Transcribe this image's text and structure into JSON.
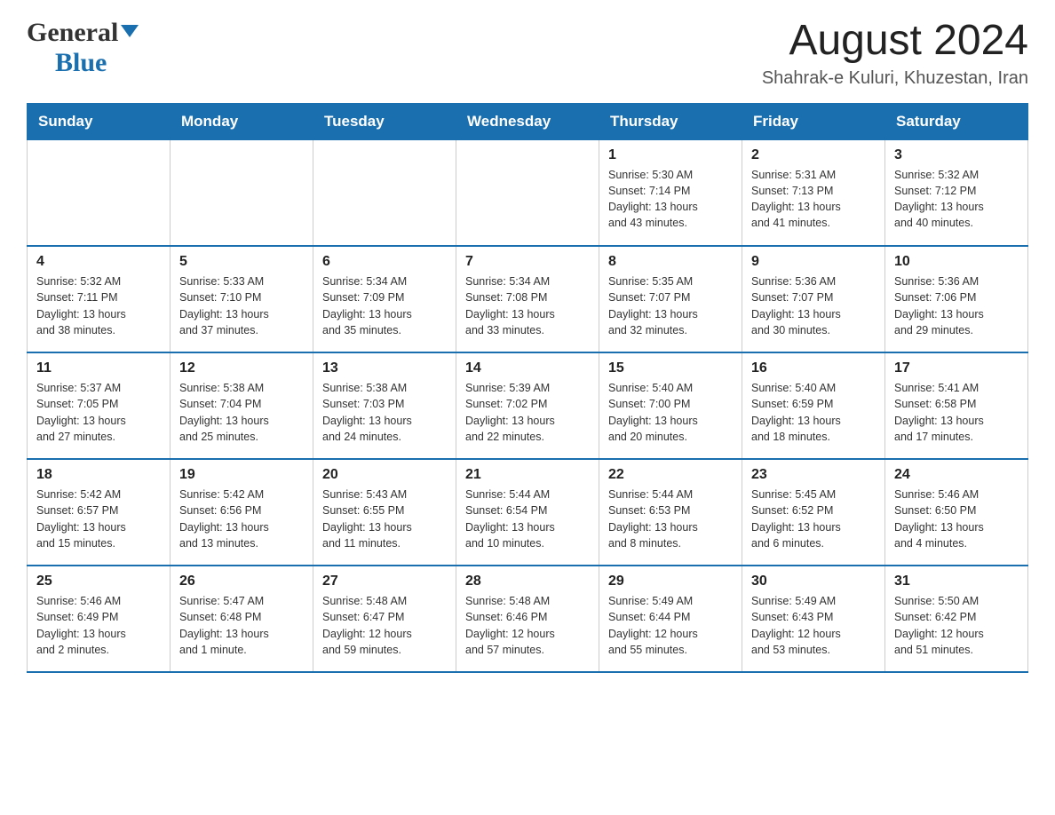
{
  "header": {
    "logo_general": "General",
    "logo_blue": "Blue",
    "month_title": "August 2024",
    "location": "Shahrak-e Kuluri, Khuzestan, Iran"
  },
  "days_of_week": [
    "Sunday",
    "Monday",
    "Tuesday",
    "Wednesday",
    "Thursday",
    "Friday",
    "Saturday"
  ],
  "weeks": [
    {
      "cells": [
        {
          "day": "",
          "info": ""
        },
        {
          "day": "",
          "info": ""
        },
        {
          "day": "",
          "info": ""
        },
        {
          "day": "",
          "info": ""
        },
        {
          "day": "1",
          "info": "Sunrise: 5:30 AM\nSunset: 7:14 PM\nDaylight: 13 hours\nand 43 minutes."
        },
        {
          "day": "2",
          "info": "Sunrise: 5:31 AM\nSunset: 7:13 PM\nDaylight: 13 hours\nand 41 minutes."
        },
        {
          "day": "3",
          "info": "Sunrise: 5:32 AM\nSunset: 7:12 PM\nDaylight: 13 hours\nand 40 minutes."
        }
      ]
    },
    {
      "cells": [
        {
          "day": "4",
          "info": "Sunrise: 5:32 AM\nSunset: 7:11 PM\nDaylight: 13 hours\nand 38 minutes."
        },
        {
          "day": "5",
          "info": "Sunrise: 5:33 AM\nSunset: 7:10 PM\nDaylight: 13 hours\nand 37 minutes."
        },
        {
          "day": "6",
          "info": "Sunrise: 5:34 AM\nSunset: 7:09 PM\nDaylight: 13 hours\nand 35 minutes."
        },
        {
          "day": "7",
          "info": "Sunrise: 5:34 AM\nSunset: 7:08 PM\nDaylight: 13 hours\nand 33 minutes."
        },
        {
          "day": "8",
          "info": "Sunrise: 5:35 AM\nSunset: 7:07 PM\nDaylight: 13 hours\nand 32 minutes."
        },
        {
          "day": "9",
          "info": "Sunrise: 5:36 AM\nSunset: 7:07 PM\nDaylight: 13 hours\nand 30 minutes."
        },
        {
          "day": "10",
          "info": "Sunrise: 5:36 AM\nSunset: 7:06 PM\nDaylight: 13 hours\nand 29 minutes."
        }
      ]
    },
    {
      "cells": [
        {
          "day": "11",
          "info": "Sunrise: 5:37 AM\nSunset: 7:05 PM\nDaylight: 13 hours\nand 27 minutes."
        },
        {
          "day": "12",
          "info": "Sunrise: 5:38 AM\nSunset: 7:04 PM\nDaylight: 13 hours\nand 25 minutes."
        },
        {
          "day": "13",
          "info": "Sunrise: 5:38 AM\nSunset: 7:03 PM\nDaylight: 13 hours\nand 24 minutes."
        },
        {
          "day": "14",
          "info": "Sunrise: 5:39 AM\nSunset: 7:02 PM\nDaylight: 13 hours\nand 22 minutes."
        },
        {
          "day": "15",
          "info": "Sunrise: 5:40 AM\nSunset: 7:00 PM\nDaylight: 13 hours\nand 20 minutes."
        },
        {
          "day": "16",
          "info": "Sunrise: 5:40 AM\nSunset: 6:59 PM\nDaylight: 13 hours\nand 18 minutes."
        },
        {
          "day": "17",
          "info": "Sunrise: 5:41 AM\nSunset: 6:58 PM\nDaylight: 13 hours\nand 17 minutes."
        }
      ]
    },
    {
      "cells": [
        {
          "day": "18",
          "info": "Sunrise: 5:42 AM\nSunset: 6:57 PM\nDaylight: 13 hours\nand 15 minutes."
        },
        {
          "day": "19",
          "info": "Sunrise: 5:42 AM\nSunset: 6:56 PM\nDaylight: 13 hours\nand 13 minutes."
        },
        {
          "day": "20",
          "info": "Sunrise: 5:43 AM\nSunset: 6:55 PM\nDaylight: 13 hours\nand 11 minutes."
        },
        {
          "day": "21",
          "info": "Sunrise: 5:44 AM\nSunset: 6:54 PM\nDaylight: 13 hours\nand 10 minutes."
        },
        {
          "day": "22",
          "info": "Sunrise: 5:44 AM\nSunset: 6:53 PM\nDaylight: 13 hours\nand 8 minutes."
        },
        {
          "day": "23",
          "info": "Sunrise: 5:45 AM\nSunset: 6:52 PM\nDaylight: 13 hours\nand 6 minutes."
        },
        {
          "day": "24",
          "info": "Sunrise: 5:46 AM\nSunset: 6:50 PM\nDaylight: 13 hours\nand 4 minutes."
        }
      ]
    },
    {
      "cells": [
        {
          "day": "25",
          "info": "Sunrise: 5:46 AM\nSunset: 6:49 PM\nDaylight: 13 hours\nand 2 minutes."
        },
        {
          "day": "26",
          "info": "Sunrise: 5:47 AM\nSunset: 6:48 PM\nDaylight: 13 hours\nand 1 minute."
        },
        {
          "day": "27",
          "info": "Sunrise: 5:48 AM\nSunset: 6:47 PM\nDaylight: 12 hours\nand 59 minutes."
        },
        {
          "day": "28",
          "info": "Sunrise: 5:48 AM\nSunset: 6:46 PM\nDaylight: 12 hours\nand 57 minutes."
        },
        {
          "day": "29",
          "info": "Sunrise: 5:49 AM\nSunset: 6:44 PM\nDaylight: 12 hours\nand 55 minutes."
        },
        {
          "day": "30",
          "info": "Sunrise: 5:49 AM\nSunset: 6:43 PM\nDaylight: 12 hours\nand 53 minutes."
        },
        {
          "day": "31",
          "info": "Sunrise: 5:50 AM\nSunset: 6:42 PM\nDaylight: 12 hours\nand 51 minutes."
        }
      ]
    }
  ]
}
